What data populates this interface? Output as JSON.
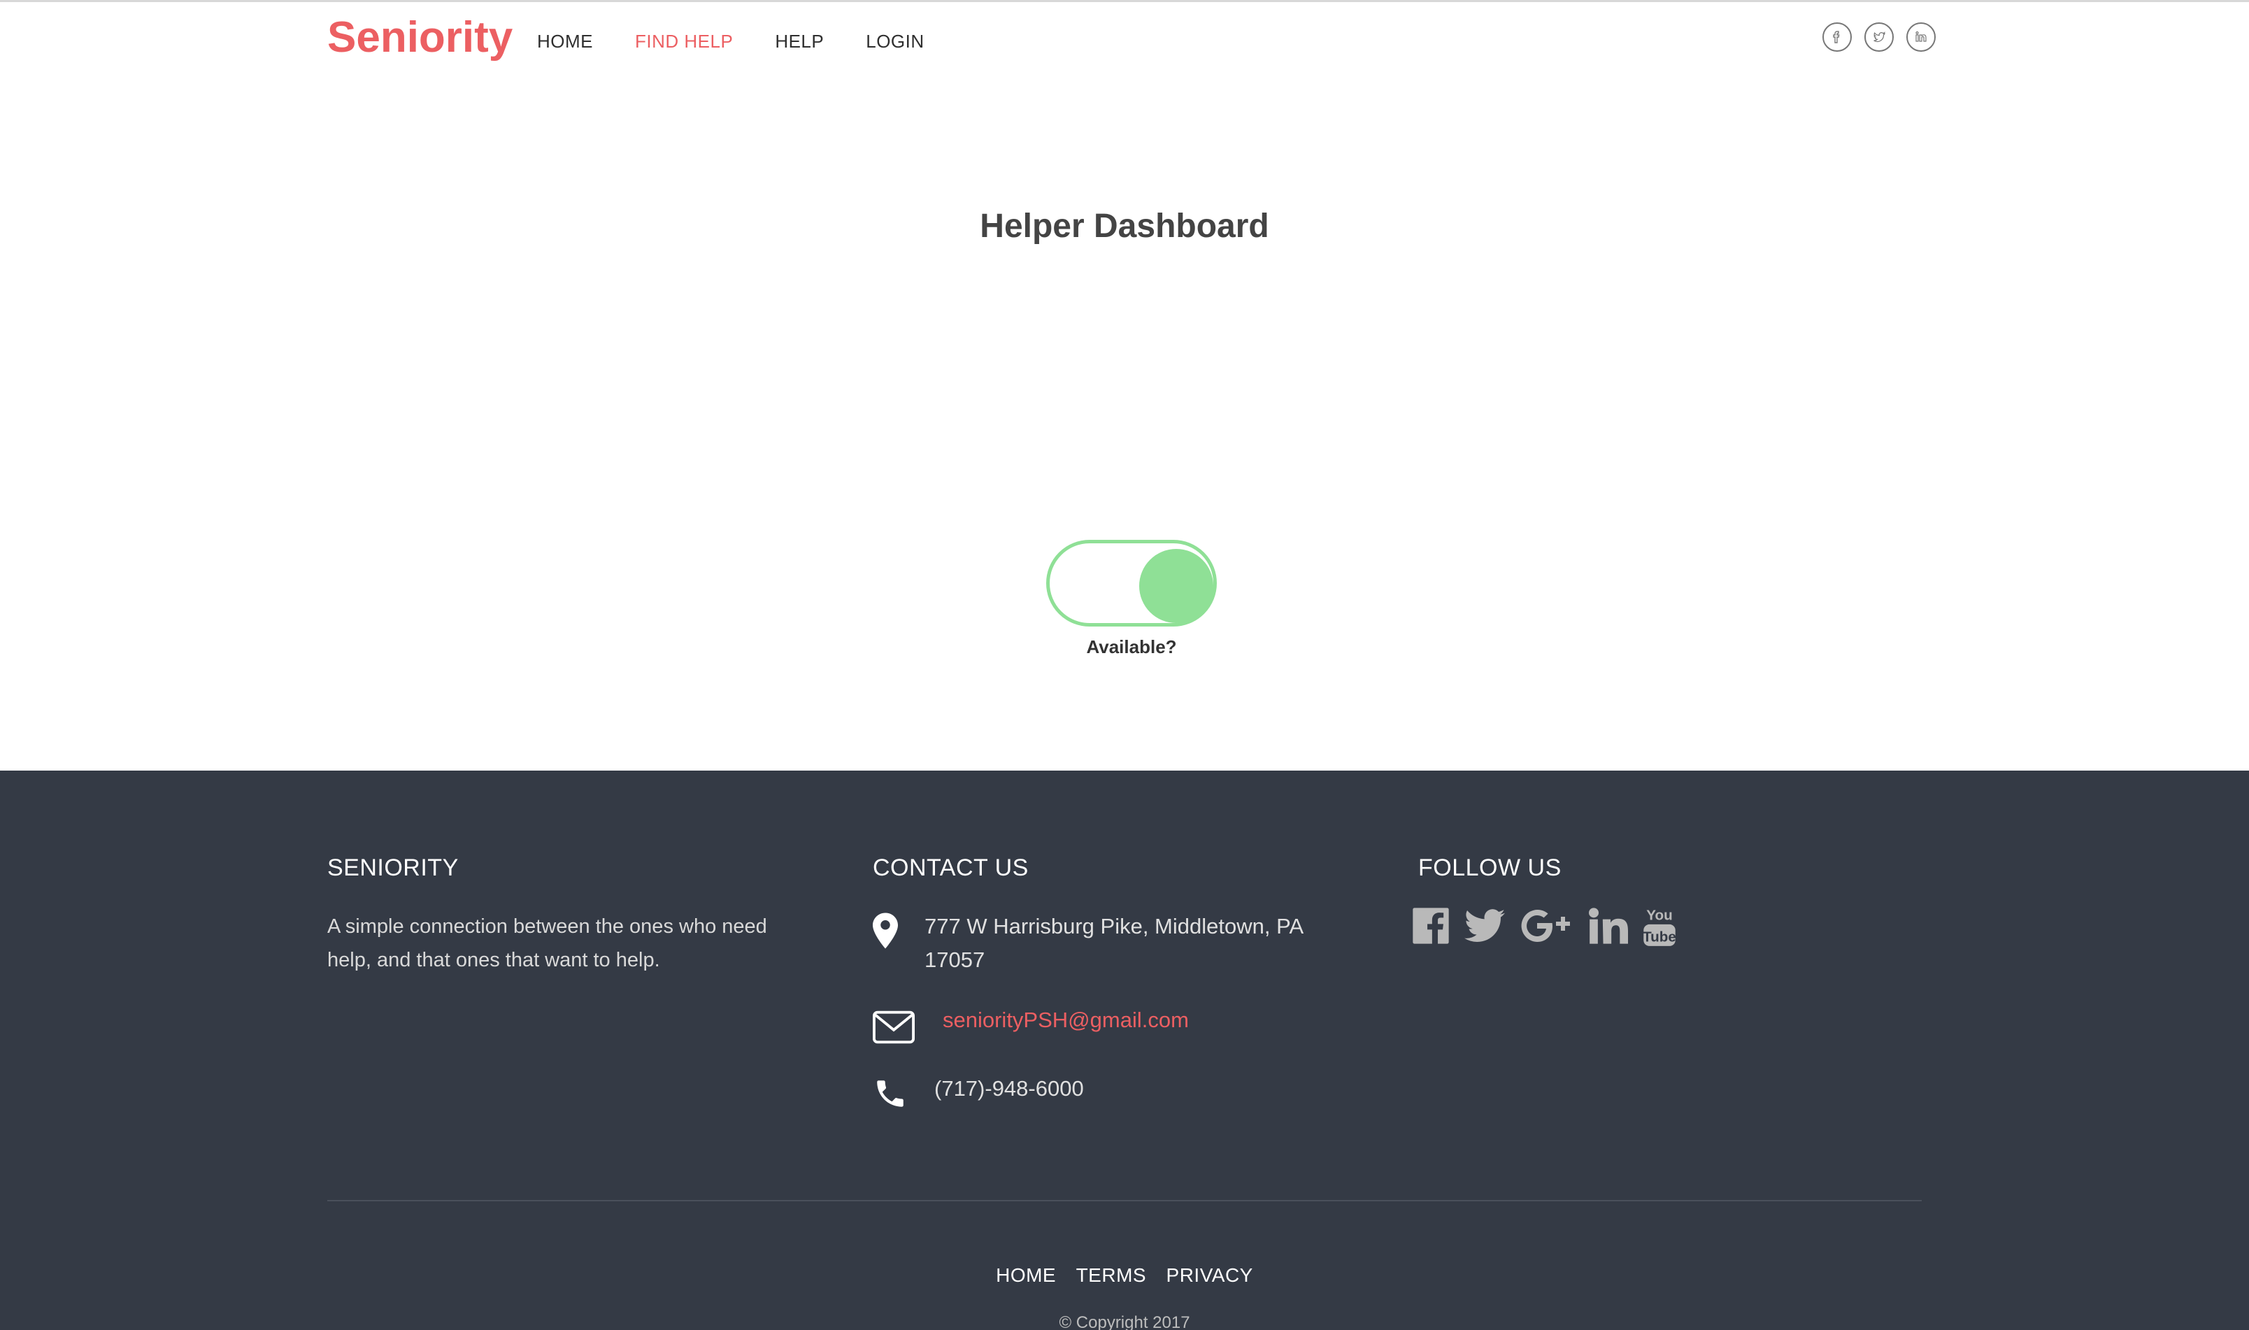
{
  "header": {
    "brand": "Seniority",
    "nav": [
      {
        "label": "HOME"
      },
      {
        "label": "FIND HELP"
      },
      {
        "label": "HELP"
      },
      {
        "label": "LOGIN"
      }
    ],
    "social_icons": [
      "facebook-icon",
      "twitter-icon",
      "linkedin-icon"
    ]
  },
  "main": {
    "title": "Helper Dashboard",
    "availability": {
      "label": "Available?",
      "state": "on",
      "accent_color": "#8fe096"
    }
  },
  "footer": {
    "about": {
      "heading": "SENIORITY",
      "text": "A simple connection between the ones who need help, and that ones that want to help."
    },
    "contact": {
      "heading": "CONTACT US",
      "address": "777 W Harrisburg Pike, Middletown, PA 17057",
      "email": "seniorityPSH@gmail.com",
      "phone": "(717)-948-6000"
    },
    "follow": {
      "heading": "FOLLOW US",
      "icons": [
        "facebook-icon",
        "twitter-icon",
        "google-plus-icon",
        "linkedin-icon",
        "youtube-icon"
      ]
    },
    "links": [
      {
        "label": "HOME"
      },
      {
        "label": "TERMS"
      },
      {
        "label": "PRIVACY"
      }
    ],
    "copyright": "© Copyright 2017"
  },
  "colors": {
    "brand": "#ec5f62",
    "footer_bg": "#343a45",
    "toggle": "#8fe096"
  }
}
